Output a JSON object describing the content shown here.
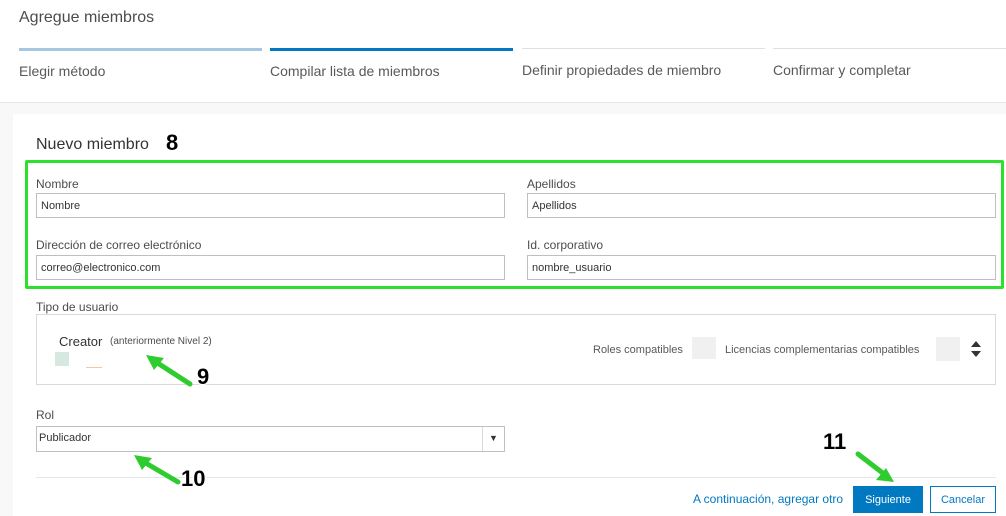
{
  "page": {
    "title": "Agregue miembros"
  },
  "steps": [
    {
      "label": "Elegir método",
      "state": "done"
    },
    {
      "label": "Compilar lista de miembros",
      "state": "active"
    },
    {
      "label": "Definir propiedades de miembro",
      "state": "pending"
    },
    {
      "label": "Confirmar y completar",
      "state": "pending"
    }
  ],
  "step_colors": {
    "done": "#a5c8e0",
    "active": "#0079c1",
    "pending": "#e0e0e0"
  },
  "form": {
    "title": "Nuevo miembro",
    "first_name": {
      "label": "Nombre",
      "value": "Nombre"
    },
    "last_name": {
      "label": "Apellidos",
      "value": "Apellidos"
    },
    "email": {
      "label": "Dirección de correo electrónico",
      "value": "correo@electronico.com"
    },
    "corporate_id": {
      "label": "Id. corporativo",
      "value": "nombre_usuario"
    }
  },
  "user_type": {
    "label": "Tipo de usuario",
    "name": "Creator",
    "note": "(anteriormente Nivel 2)",
    "roles_label": "Roles compatibles",
    "licenses_label": "Licencias complementarias compatibles"
  },
  "role": {
    "label": "Rol",
    "value": "Publicador"
  },
  "footer": {
    "continue_link": "A continuación, agregar otro",
    "next_button": "Siguiente",
    "cancel_button": "Cancelar"
  },
  "annotations": {
    "n8": "8",
    "n9": "9",
    "n10": "10",
    "n11": "11"
  },
  "colors": {
    "accent": "#0079c1",
    "highlight": "#2ee02e"
  }
}
